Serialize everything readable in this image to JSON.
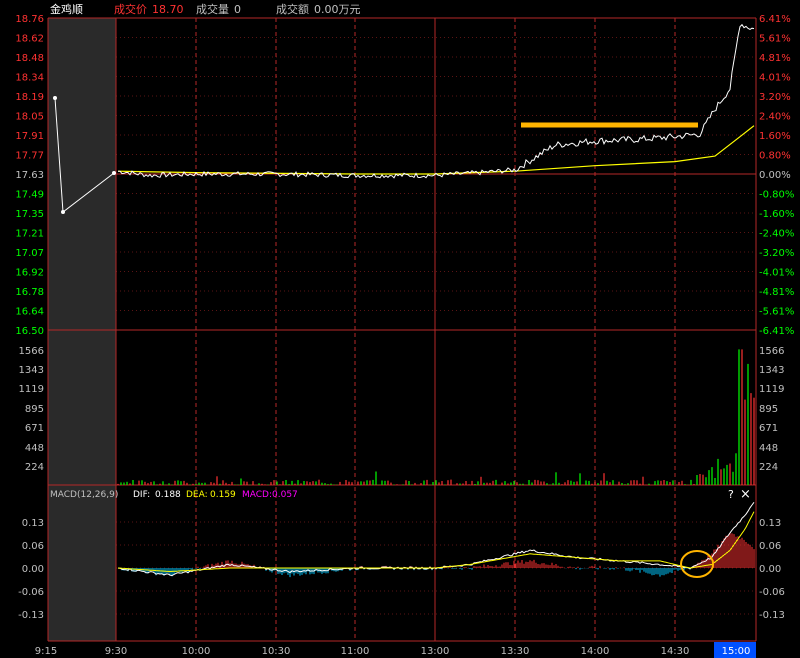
{
  "header": {
    "stock_name": "金鸡顺",
    "price_label": "成交价",
    "price_value": "18.70",
    "volume_label": "成交量",
    "volume_value": "0",
    "amount_label": "成交额",
    "amount_value": "0.00万元"
  },
  "price_axis": {
    "labels": [
      "18.76",
      "18.62",
      "18.48",
      "18.34",
      "18.19",
      "18.05",
      "17.91",
      "17.77",
      "17.63",
      "17.49",
      "17.35",
      "17.21",
      "17.07",
      "16.92",
      "16.78",
      "16.64",
      "16.50"
    ],
    "pct_labels": [
      "6.41%",
      "5.61%",
      "4.81%",
      "4.01%",
      "3.20%",
      "2.40%",
      "1.60%",
      "0.80%",
      "0.00%",
      "-0.80%",
      "-1.60%",
      "-2.40%",
      "-3.20%",
      "-4.01%",
      "-4.81%",
      "-5.61%",
      "-6.41%"
    ],
    "prev_close": 17.63,
    "range": [
      16.5,
      18.76
    ]
  },
  "volume_axis": {
    "labels": [
      "1566",
      "1343",
      "1119",
      "895",
      "671",
      "448",
      "224"
    ]
  },
  "macd": {
    "title": "MACD(12,26,9)",
    "dif_label": "DIF:",
    "dif_value": "0.188",
    "dea_label": "DEA:",
    "dea_value": "0.159",
    "macd_label": "MACD:",
    "macd_value": "0.057",
    "axis_labels": [
      "0.13",
      "0.06",
      "0.00",
      "-0.06",
      "-0.13"
    ],
    "help_icon": "?",
    "close_icon": "×"
  },
  "time_axis": {
    "labels": [
      "9:15",
      "9:30",
      "10:00",
      "10:30",
      "11:00",
      "13:00",
      "13:30",
      "14:00",
      "14:30",
      "15:00"
    ],
    "highlight": "15:00"
  },
  "colors": {
    "up": "#ff3232",
    "down": "#00ff00",
    "grid": "#b42828",
    "price_line": "#ffffff",
    "avg_line": "#ffff00",
    "annotation": "#ffb400",
    "macd": "#ff00ff",
    "time_highlight": "#0050ff"
  },
  "chart_data": [
    {
      "type": "line",
      "x_range": [
        "9:30",
        "15:00"
      ],
      "series": [
        {
          "x": [
            "9:30",
            "9:45",
            "10:00",
            "10:30",
            "11:00",
            "11:30/13:00",
            "13:15",
            "13:30",
            "13:45",
            "14:00",
            "14:15",
            "14:30",
            "14:45",
            "14:50",
            "14:55",
            "15:00"
          ],
          "values": [
            17.65,
            17.62,
            17.63,
            17.63,
            17.62,
            17.62,
            17.66,
            17.83,
            17.86,
            17.88,
            17.9,
            17.92,
            17.92,
            18.1,
            18.38,
            18.7
          ]
        },
        {
          "x": [
            "9:30",
            "10:00",
            "11:00",
            "11:30/13:00",
            "13:30",
            "14:00",
            "14:30",
            "14:45",
            "15:00"
          ],
          "values": [
            17.65,
            17.64,
            17.63,
            17.63,
            17.65,
            17.69,
            17.72,
            17.75,
            17.98
          ]
        }
      ],
      "ylim": [
        16.5,
        18.76
      ]
    },
    {
      "type": "bar",
      "ylim": [
        0,
        1790
      ],
      "note": "volume bars concentrated near close; largest around 1566"
    },
    {
      "type": "line",
      "ylim": [
        -0.16,
        0.2
      ],
      "series": [
        {
          "values": [
            0.0,
            0.0,
            0.01,
            -0.01,
            0.01,
            0.0,
            0.05,
            0.02,
            0.0,
            0.01,
            0.1,
            0.188
          ]
        },
        {
          "values": [
            0.0,
            0.0,
            0.01,
            0.0,
            0.0,
            0.0,
            0.04,
            0.03,
            0.01,
            0.0,
            0.06,
            0.159
          ]
        }
      ]
    }
  ]
}
